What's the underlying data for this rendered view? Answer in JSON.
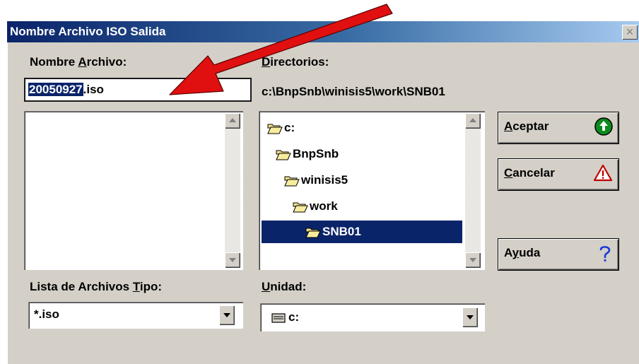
{
  "window": {
    "title": "Nombre Archivo ISO Salida",
    "close_glyph": "×"
  },
  "filename": {
    "label_pre": "Nombre ",
    "label_key": "A",
    "label_post": "rchivo:",
    "value_selected": "20050927",
    "value_rest": ".iso"
  },
  "directories": {
    "label_key": "D",
    "label_post": "irectorios:",
    "path": "c:\\BnpSnb\\winisis5\\work\\SNB01",
    "items": [
      {
        "label": "c:"
      },
      {
        "label": "BnpSnb"
      },
      {
        "label": "winisis5"
      },
      {
        "label": "work"
      },
      {
        "label": "SNB01"
      }
    ],
    "selected_index": 4
  },
  "file_type": {
    "label_pre": "Lista de Archivos ",
    "label_key": "T",
    "label_post": "ipo:",
    "value": "*.iso"
  },
  "drive": {
    "label_key": "U",
    "label_post": "nidad:",
    "value": "c:"
  },
  "buttons": {
    "accept": {
      "key": "A",
      "rest": "ceptar",
      "icon": "green-up-arrow-icon"
    },
    "cancel": {
      "key": "C",
      "rest": "ancelar",
      "icon": "warning-triangle-icon"
    },
    "help": {
      "pre": "A",
      "key": "y",
      "rest": "uda",
      "icon": "question-mark-icon"
    }
  },
  "colors": {
    "title_bar": "#0a246a",
    "selection": "#0a246a",
    "dialog_bg": "#d4d0c8",
    "annotation_arrow": "#e01010"
  }
}
